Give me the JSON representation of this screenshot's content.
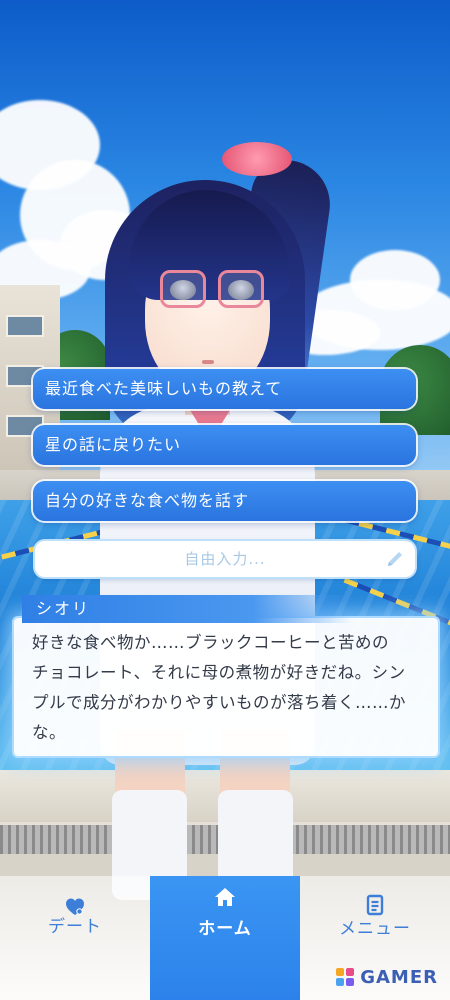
{
  "choices": [
    {
      "label": "最近食べた美味しいもの教えて"
    },
    {
      "label": "星の話に戻りたい"
    },
    {
      "label": "自分の好きな食べ物を話す"
    }
  ],
  "free_input": {
    "placeholder": "自由入力..."
  },
  "dialog": {
    "speaker": "シオリ",
    "lines": [
      "好きな食べ物か……ブラックコーヒーと苦めの",
      "チョコレート、それに母の煮物が好きだね。シン",
      "プルで成分がわかりやすいものが落ち着く……か",
      "な。"
    ]
  },
  "nav": {
    "date": {
      "label": "デート",
      "icon": "heart-icon"
    },
    "home": {
      "label": "ホーム",
      "icon": "home-icon",
      "active": true
    },
    "menu": {
      "label": "メニュー",
      "icon": "menu-list-icon"
    }
  },
  "watermark": {
    "text": "GAMER"
  },
  "colors": {
    "accent": "#2c82ea",
    "button": "#2a74df",
    "nav_text": "#3d7fd8"
  }
}
